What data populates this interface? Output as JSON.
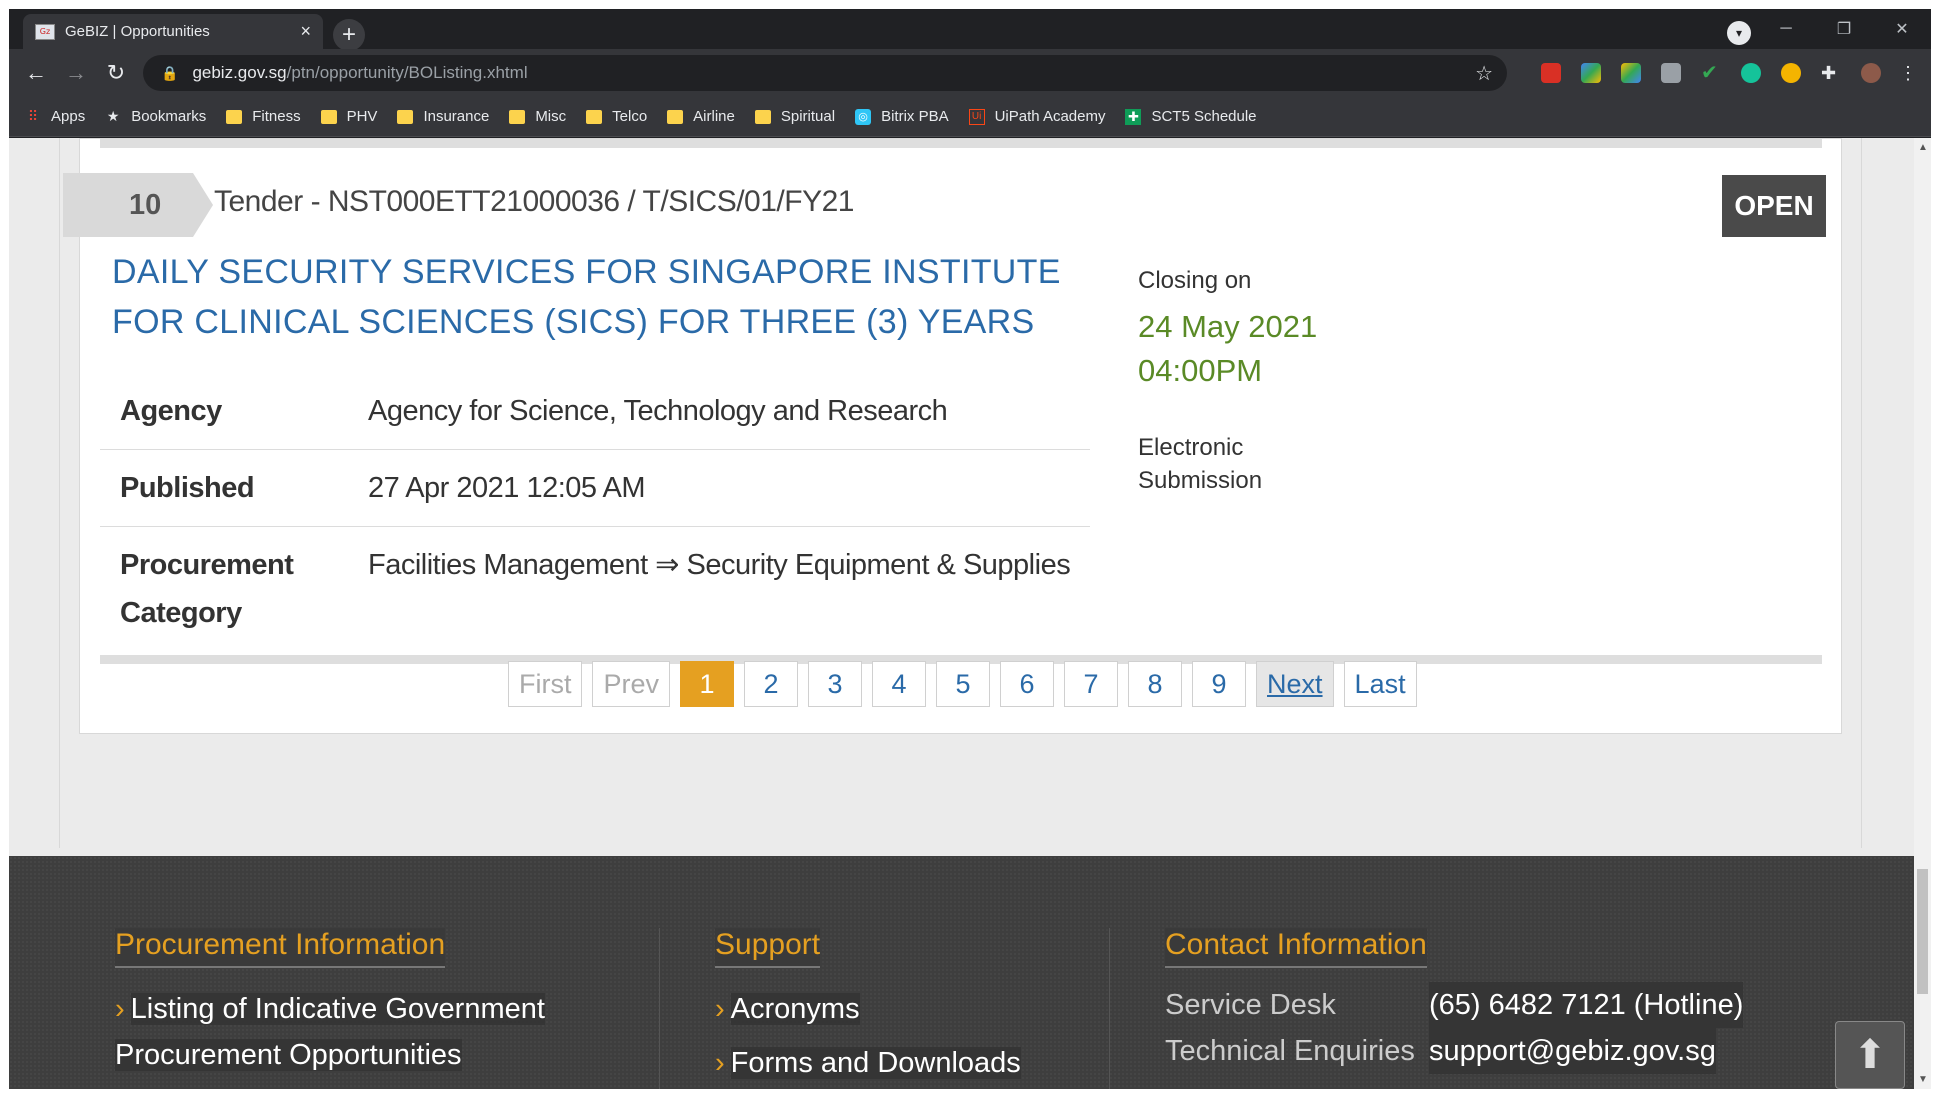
{
  "browser": {
    "tab_title": "GeBIZ | Opportunities",
    "tab_close": "×",
    "new_tab": "+",
    "url_host": "gebiz.gov.sg",
    "url_path": "/ptn/opportunity/BOListing.xhtml",
    "bookmarks": [
      {
        "label": "Apps",
        "icon": "apps-grid-icon"
      },
      {
        "label": "Bookmarks",
        "icon": "star-icon"
      },
      {
        "label": "Fitness",
        "icon": "folder-icon"
      },
      {
        "label": "PHV",
        "icon": "folder-icon"
      },
      {
        "label": "Insurance",
        "icon": "folder-icon"
      },
      {
        "label": "Misc",
        "icon": "folder-icon"
      },
      {
        "label": "Telco",
        "icon": "folder-icon"
      },
      {
        "label": "Airline",
        "icon": "folder-icon"
      },
      {
        "label": "Spiritual",
        "icon": "folder-icon"
      },
      {
        "label": "Bitrix PBA",
        "icon": "bitrix-icon"
      },
      {
        "label": "UiPath Academy",
        "icon": "uipath-icon"
      },
      {
        "label": "SCT5 Schedule",
        "icon": "sheets-icon"
      }
    ]
  },
  "opportunity": {
    "index": "10",
    "reference": "Tender - NST000ETT21000036 / T/SICS/01/FY21",
    "status": "OPEN",
    "title": "DAILY SECURITY SERVICES FOR SINGAPORE INSTITUTE FOR CLINICAL SCIENCES (SICS) FOR THREE (3) YEARS",
    "details": [
      {
        "key": "Agency",
        "value": "Agency for Science, Technology and Research"
      },
      {
        "key": "Published",
        "value": "27 Apr 2021 12:05 AM"
      },
      {
        "key": "Procurement Category",
        "value": "Facilities Management ⇒ Security Equipment & Supplies"
      }
    ],
    "closing_label": "Closing on",
    "closing_date": "24 May 2021",
    "closing_time": "04:00PM",
    "submission": "Electronic Submission"
  },
  "pagination": {
    "first": "First",
    "prev": "Prev",
    "pages": [
      "1",
      "2",
      "3",
      "4",
      "5",
      "6",
      "7",
      "8",
      "9"
    ],
    "current": "1",
    "next": "Next",
    "last": "Last"
  },
  "footer": {
    "procurement": {
      "heading": "Procurement Information",
      "links": [
        "Listing of Indicative Government Procurement Opportunities"
      ]
    },
    "support": {
      "heading": "Support",
      "links": [
        "Acronyms",
        "Forms and Downloads"
      ]
    },
    "contact": {
      "heading": "Contact Information",
      "rows": [
        {
          "key": "Service Desk",
          "value": "(65) 6482 7121 (Hotline)"
        },
        {
          "key": "Technical Enquiries",
          "value": "support@gebiz.gov.sg"
        }
      ]
    }
  },
  "colors": {
    "accent": "#e5a021",
    "title_blue": "#2a6aa8",
    "closing_green": "#5a8a26",
    "status_bg": "#4a4a4a"
  }
}
